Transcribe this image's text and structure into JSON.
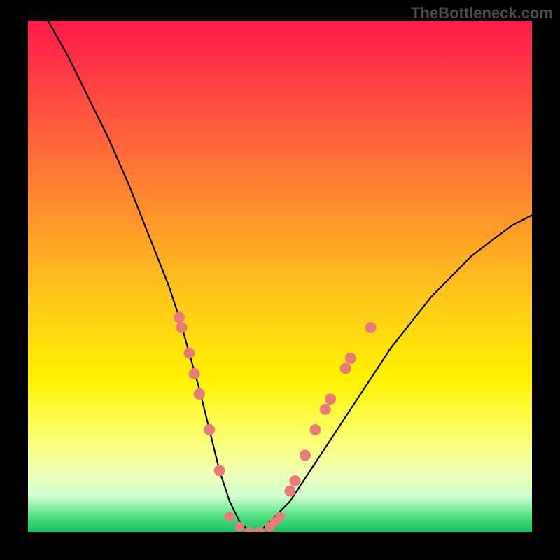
{
  "watermark": "TheBottleneck.com",
  "chart_data": {
    "type": "line",
    "title": "",
    "xlabel": "",
    "ylabel": "",
    "xlim": [
      0,
      100
    ],
    "ylim": [
      0,
      100
    ],
    "series": [
      {
        "name": "curve",
        "x": [
          4,
          8,
          12,
          16,
          20,
          24,
          28,
          30,
          32,
          34,
          36,
          38,
          40,
          42,
          44,
          46,
          48,
          52,
          56,
          60,
          64,
          68,
          72,
          76,
          80,
          84,
          88,
          92,
          96,
          100
        ],
        "y": [
          100,
          93,
          85,
          77,
          68,
          58,
          48,
          42,
          35,
          28,
          20,
          12,
          6,
          2,
          0,
          0,
          2,
          6,
          12,
          18,
          24,
          30,
          36,
          41,
          46,
          50,
          54,
          57,
          60,
          62
        ]
      }
    ],
    "markers": {
      "left_branch": [
        {
          "x": 30,
          "y": 42
        },
        {
          "x": 30.5,
          "y": 40
        },
        {
          "x": 32,
          "y": 35
        },
        {
          "x": 33,
          "y": 31
        },
        {
          "x": 34,
          "y": 27
        },
        {
          "x": 36,
          "y": 20
        },
        {
          "x": 38,
          "y": 12
        }
      ],
      "bottom": [
        {
          "x": 40,
          "y": 3
        },
        {
          "x": 42,
          "y": 1
        },
        {
          "x": 44,
          "y": 0
        },
        {
          "x": 46,
          "y": 0
        },
        {
          "x": 48,
          "y": 1
        },
        {
          "x": 49,
          "y": 2
        },
        {
          "x": 50,
          "y": 3
        }
      ],
      "right_branch": [
        {
          "x": 52,
          "y": 8
        },
        {
          "x": 53,
          "y": 10
        },
        {
          "x": 55,
          "y": 15
        },
        {
          "x": 57,
          "y": 20
        },
        {
          "x": 59,
          "y": 24
        },
        {
          "x": 60,
          "y": 26
        },
        {
          "x": 63,
          "y": 32
        },
        {
          "x": 64,
          "y": 34
        },
        {
          "x": 68,
          "y": 40
        }
      ]
    },
    "gradient_colors": {
      "top": "#ff1a4a",
      "mid": "#fff200",
      "bottom": "#10c060"
    }
  }
}
